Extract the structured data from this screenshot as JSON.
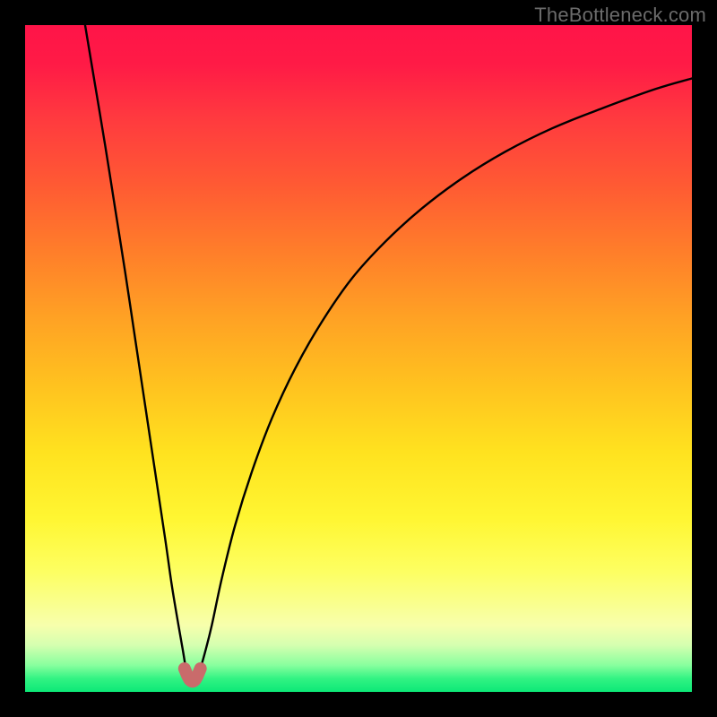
{
  "watermark": {
    "text": "TheBottleneck.com"
  },
  "colors": {
    "background": "#000000",
    "curve": "#000000",
    "marker": "#c96b6b",
    "gradient_top": "#ff1448",
    "gradient_bottom": "#0ce877"
  },
  "chart_data": {
    "type": "line",
    "title": "",
    "xlabel": "",
    "ylabel": "",
    "xlim": [
      0,
      100
    ],
    "ylim": [
      0,
      100
    ],
    "grid": false,
    "legend": false,
    "annotations": [
      {
        "text": "TheBottleneck.com",
        "position": "top-right"
      }
    ],
    "series": [
      {
        "name": "left-branch",
        "x": [
          9,
          10.5,
          12,
          13.5,
          15,
          16.5,
          18,
          19.5,
          21,
          22,
          23,
          23.7,
          24.1
        ],
        "y": [
          100,
          91,
          82,
          72.5,
          63,
          53,
          43,
          33,
          23,
          16,
          10,
          6,
          3.5
        ]
      },
      {
        "name": "right-branch",
        "x": [
          26.3,
          27,
          28,
          29.5,
          31.5,
          34,
          37,
          40.5,
          44.5,
          49,
          54,
          59.5,
          65.5,
          72,
          79,
          86.5,
          94.5,
          100
        ],
        "y": [
          3.5,
          6,
          10,
          17,
          25,
          33,
          41,
          48.5,
          55.5,
          62,
          67.5,
          72.5,
          77,
          81,
          84.5,
          87.5,
          90.4,
          92
        ]
      },
      {
        "name": "optimum-marker",
        "x": [
          23.9,
          24.7,
          25.5,
          26.3
        ],
        "y": [
          3.5,
          1.8,
          1.8,
          3.5
        ]
      }
    ]
  }
}
